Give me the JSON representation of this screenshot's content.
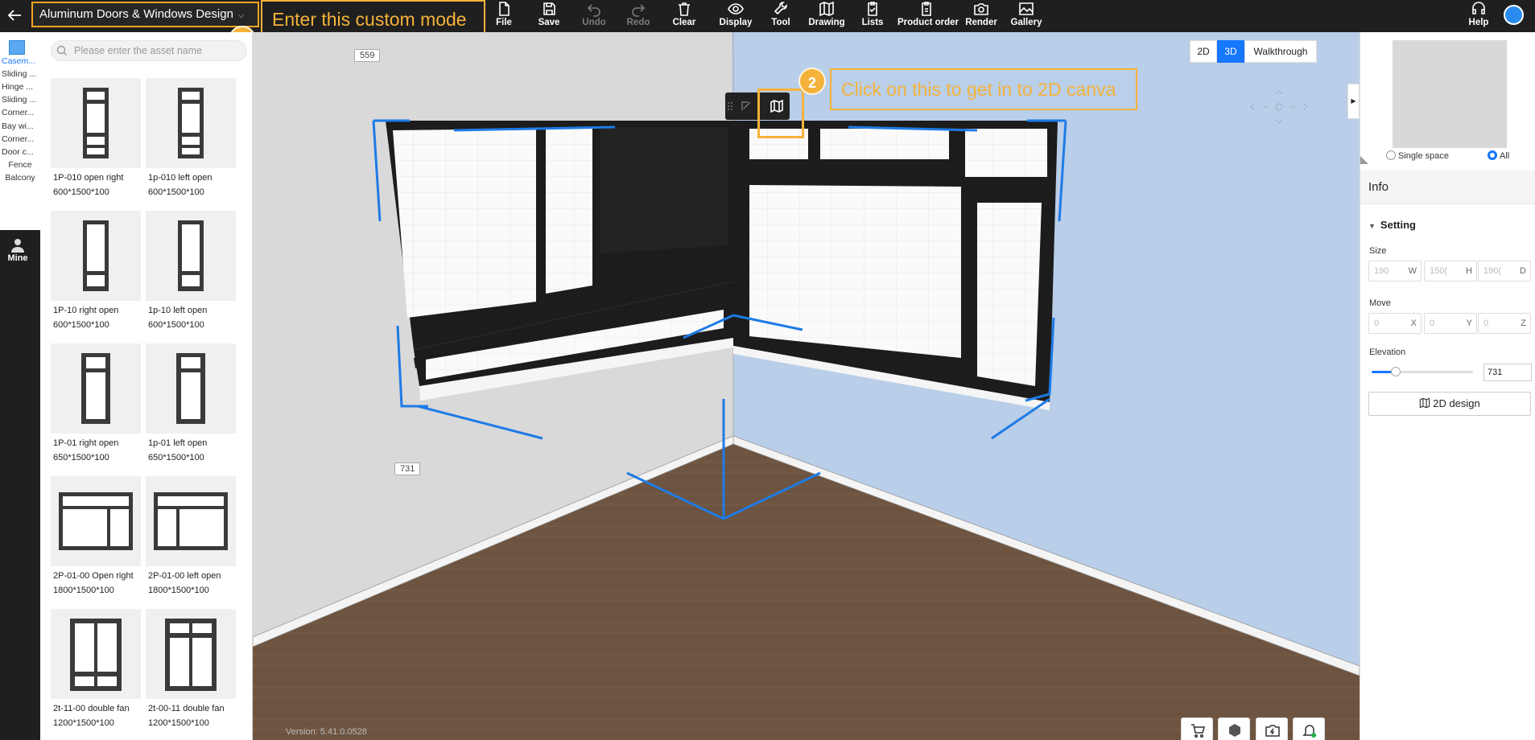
{
  "topbar": {
    "mode_label": "Aluminum Doors & Windows Design",
    "items": [
      {
        "label": "File",
        "icon": "file-icon",
        "enabled": true
      },
      {
        "label": "Save",
        "icon": "save-icon",
        "enabled": true
      },
      {
        "label": "Undo",
        "icon": "undo-icon",
        "enabled": false
      },
      {
        "label": "Redo",
        "icon": "redo-icon",
        "enabled": false
      },
      {
        "label": "Clear",
        "icon": "trash-icon",
        "enabled": true
      },
      {
        "label": "Display",
        "icon": "eye-icon",
        "enabled": true
      },
      {
        "label": "Tool",
        "icon": "wrench-icon",
        "enabled": true
      },
      {
        "label": "Drawing",
        "icon": "map-icon",
        "enabled": true
      },
      {
        "label": "Lists",
        "icon": "clipboard-icon",
        "enabled": true
      },
      {
        "label": "Product order",
        "icon": "order-icon",
        "enabled": true
      },
      {
        "label": "Render",
        "icon": "camera-icon",
        "enabled": true
      },
      {
        "label": "Gallery",
        "icon": "image-icon",
        "enabled": true
      }
    ],
    "help_label": "Help"
  },
  "annotations": {
    "step1_number": "1",
    "step1_text": "Enter this custom mode",
    "step2_number": "2",
    "step2_text": "Click on this to get in to 2D canva"
  },
  "categories": {
    "items": [
      "Casem...",
      "Sliding ...",
      "Hinge ...",
      "Sliding ...",
      "Corner...",
      "Bay wi...",
      "Corner...",
      "Door c...",
      "Fence",
      "Balcony"
    ],
    "active_index": 0,
    "mine_label": "Mine"
  },
  "assets": {
    "search_placeholder": "Please enter the asset name",
    "items": [
      {
        "name": "1P-010 open right",
        "dims": "600*1500*100"
      },
      {
        "name": "1p-010 left open",
        "dims": "600*1500*100"
      },
      {
        "name": "1P-10 right open",
        "dims": "600*1500*100"
      },
      {
        "name": "1p-10 left open",
        "dims": "600*1500*100"
      },
      {
        "name": "1P-01 right open",
        "dims": "650*1500*100"
      },
      {
        "name": "1p-01 left open",
        "dims": "650*1500*100"
      },
      {
        "name": "2P-01-00 Open right",
        "dims": "1800*1500*100"
      },
      {
        "name": "2P-01-00 left open",
        "dims": "1800*1500*100"
      },
      {
        "name": "2t-11-00 double fan",
        "dims": "1200*1500*100"
      },
      {
        "name": "2t-00-11 double fan",
        "dims": "1200*1500*100"
      }
    ]
  },
  "viewport": {
    "view_modes": [
      "2D",
      "3D",
      "Walkthrough"
    ],
    "active_view": "3D",
    "dim_top": "559",
    "dim_side": "731",
    "version": "Version: 5.41.0.0528",
    "colors": {
      "wall_left": "#d9d9d9",
      "wall_right": "#b8cde6",
      "floor": "#6e5641",
      "selection": "#1e7be6",
      "accent": "#f5b23a"
    }
  },
  "right_panel": {
    "radio_single": "Single space",
    "radio_all": "All",
    "radio_selected": "All",
    "info_title": "Info",
    "setting_title": "Setting",
    "size_label": "Size",
    "size_fields": [
      {
        "value": "190",
        "axis": "W"
      },
      {
        "value": "150(",
        "axis": "H"
      },
      {
        "value": "190(",
        "axis": "D"
      }
    ],
    "move_label": "Move",
    "move_fields": [
      {
        "value": "0",
        "axis": "X"
      },
      {
        "value": "0",
        "axis": "Y"
      },
      {
        "value": "0",
        "axis": "Z"
      }
    ],
    "elevation_label": "Elevation",
    "elevation_value": "731",
    "elevation_slider_fraction": 0.24,
    "design_button": "2D design"
  }
}
